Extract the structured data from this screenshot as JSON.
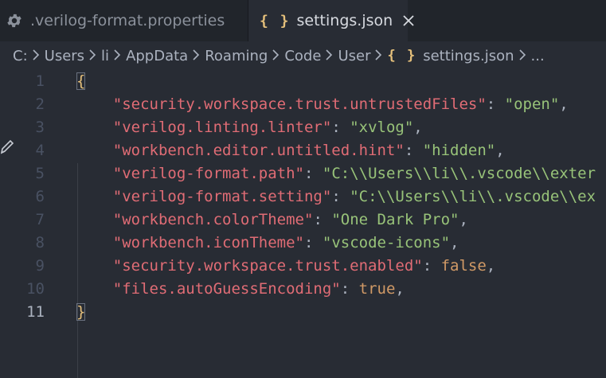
{
  "tabs": [
    {
      "label": ".verilog-format.properties",
      "icon": "gear-icon",
      "active": false
    },
    {
      "label": "settings.json",
      "icon": "json-braces-icon",
      "active": true,
      "close_glyph": "✕"
    }
  ],
  "json_icon_glyph": "{ }",
  "breadcrumb": {
    "parts": [
      "C:",
      "Users",
      "li",
      "AppData",
      "Roaming",
      "Code",
      "User",
      "settings.json",
      "..."
    ]
  },
  "editor": {
    "lines": [
      {
        "n": "1",
        "tokens": [
          {
            "t": "{",
            "c": "brace"
          }
        ]
      },
      {
        "n": "2",
        "tokens": [
          {
            "t": "    ",
            "c": "p"
          },
          {
            "t": "\"security.workspace.trust.untrustedFiles\"",
            "c": "k"
          },
          {
            "t": ": ",
            "c": "p"
          },
          {
            "t": "\"open\"",
            "c": "s"
          },
          {
            "t": ",",
            "c": "p"
          }
        ]
      },
      {
        "n": "3",
        "tokens": [
          {
            "t": "    ",
            "c": "p"
          },
          {
            "t": "\"verilog.linting.linter\"",
            "c": "k"
          },
          {
            "t": ": ",
            "c": "p"
          },
          {
            "t": "\"xvlog\"",
            "c": "s"
          },
          {
            "t": ",",
            "c": "p"
          }
        ]
      },
      {
        "n": "4",
        "tokens": [
          {
            "t": "    ",
            "c": "p"
          },
          {
            "t": "\"workbench.editor.untitled.hint\"",
            "c": "k"
          },
          {
            "t": ": ",
            "c": "p"
          },
          {
            "t": "\"hidden\"",
            "c": "s"
          },
          {
            "t": ",",
            "c": "p"
          }
        ]
      },
      {
        "n": "5",
        "tokens": [
          {
            "t": "    ",
            "c": "p"
          },
          {
            "t": "\"verilog-format.path\"",
            "c": "k"
          },
          {
            "t": ": ",
            "c": "p"
          },
          {
            "t": "\"C:\\\\Users\\\\li\\\\.vscode\\\\exter",
            "c": "s"
          }
        ]
      },
      {
        "n": "6",
        "tokens": [
          {
            "t": "    ",
            "c": "p"
          },
          {
            "t": "\"verilog-format.setting\"",
            "c": "k"
          },
          {
            "t": ": ",
            "c": "p"
          },
          {
            "t": "\"C:\\\\Users\\\\li\\\\.vscode\\\\ex",
            "c": "s"
          }
        ]
      },
      {
        "n": "7",
        "tokens": [
          {
            "t": "    ",
            "c": "p"
          },
          {
            "t": "\"workbench.colorTheme\"",
            "c": "k"
          },
          {
            "t": ": ",
            "c": "p"
          },
          {
            "t": "\"One Dark Pro\"",
            "c": "s"
          },
          {
            "t": ",",
            "c": "p"
          }
        ]
      },
      {
        "n": "8",
        "tokens": [
          {
            "t": "    ",
            "c": "p"
          },
          {
            "t": "\"workbench.iconTheme\"",
            "c": "k"
          },
          {
            "t": ": ",
            "c": "p"
          },
          {
            "t": "\"vscode-icons\"",
            "c": "s"
          },
          {
            "t": ",",
            "c": "p"
          }
        ]
      },
      {
        "n": "9",
        "tokens": [
          {
            "t": "    ",
            "c": "p"
          },
          {
            "t": "\"security.workspace.trust.enabled\"",
            "c": "k"
          },
          {
            "t": ": ",
            "c": "p"
          },
          {
            "t": "false",
            "c": "kw"
          },
          {
            "t": ",",
            "c": "p"
          }
        ]
      },
      {
        "n": "10",
        "tokens": [
          {
            "t": "    ",
            "c": "p"
          },
          {
            "t": "\"files.autoGuessEncoding\"",
            "c": "k"
          },
          {
            "t": ": ",
            "c": "p"
          },
          {
            "t": "true",
            "c": "kw"
          },
          {
            "t": ",",
            "c": "p"
          }
        ]
      },
      {
        "n": "11",
        "tokens": [
          {
            "t": "}",
            "c": "brace"
          }
        ],
        "current": true
      }
    ]
  },
  "colors": {
    "background": "#282c34",
    "tabbar": "#21252b",
    "key": "#e06c75",
    "string": "#98c379",
    "keyword": "#d19a66",
    "brace": "#e5c07b"
  }
}
